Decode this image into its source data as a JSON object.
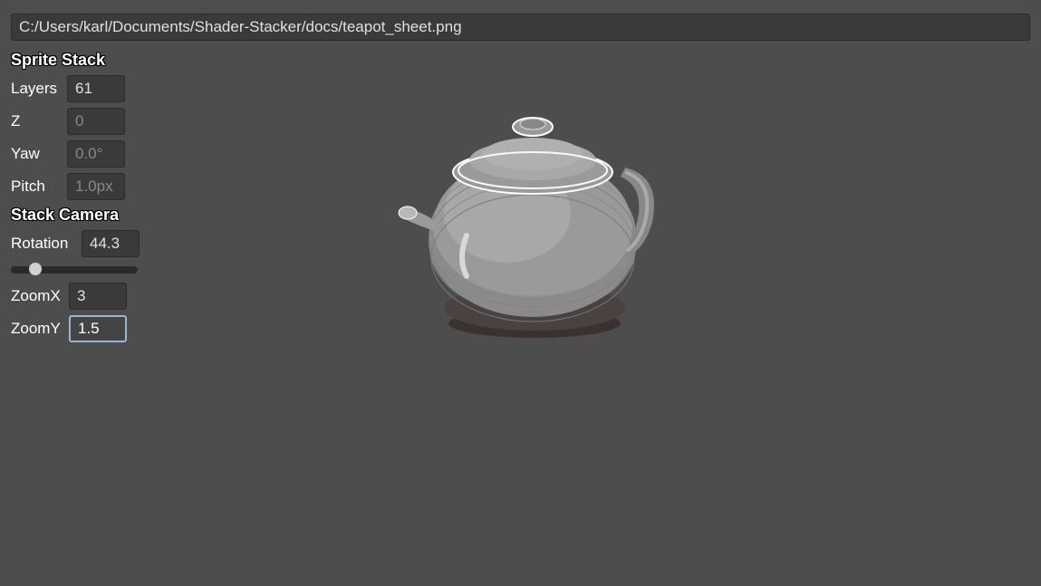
{
  "pathBar": {
    "value": "C:/Users/karl/Documents/Shader-Stacker/docs/teapot_sheet.png"
  },
  "sections": {
    "spriteStack": {
      "title": "Sprite Stack",
      "layers": {
        "label": "Layers",
        "value": "61"
      },
      "z": {
        "label": "Z",
        "placeholder": "0",
        "value": ""
      },
      "yaw": {
        "label": "Yaw",
        "placeholder": "0.0°",
        "value": ""
      },
      "pitch": {
        "label": "Pitch",
        "placeholder": "1.0px",
        "value": ""
      }
    },
    "stackCamera": {
      "title": "Stack Camera",
      "rotation": {
        "label": "Rotation",
        "value": "44.3"
      },
      "sliderPercent": 16,
      "zoomX": {
        "label": "ZoomX",
        "value": "3"
      },
      "zoomY": {
        "label": "ZoomY",
        "value": "1.5"
      }
    }
  }
}
